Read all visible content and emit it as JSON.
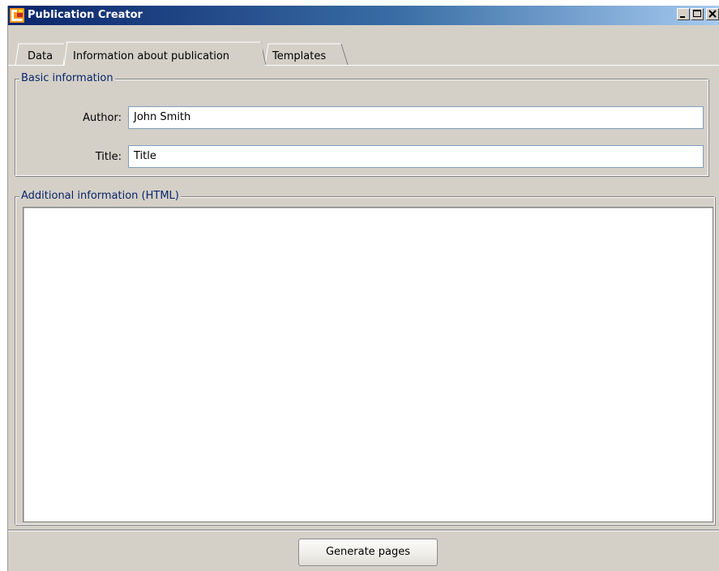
{
  "window": {
    "title": "Publication Creator",
    "app_icon": "publication-creator-icon",
    "controls": {
      "minimize_icon": "minimize-icon",
      "maximize_icon": "maximize-icon",
      "close_icon": "close-icon"
    }
  },
  "tabs": [
    {
      "label": "Data",
      "active": false
    },
    {
      "label": "Information about publication",
      "active": true
    },
    {
      "label": "Templates",
      "active": false
    }
  ],
  "basic_information": {
    "legend": "Basic information",
    "author": {
      "label": "Author:",
      "value": "John Smith"
    },
    "title": {
      "label": "Title:",
      "value": "Title"
    }
  },
  "additional_information": {
    "legend": "Additional information (HTML)",
    "value": ""
  },
  "actions": {
    "generate_label": "Generate pages"
  },
  "colors": {
    "window_bg": "#d4d0c8",
    "titlebar_start": "#0a246a",
    "titlebar_end": "#a6caf0",
    "legend_text": "#0a246a",
    "field_border": "#7f9db9"
  }
}
